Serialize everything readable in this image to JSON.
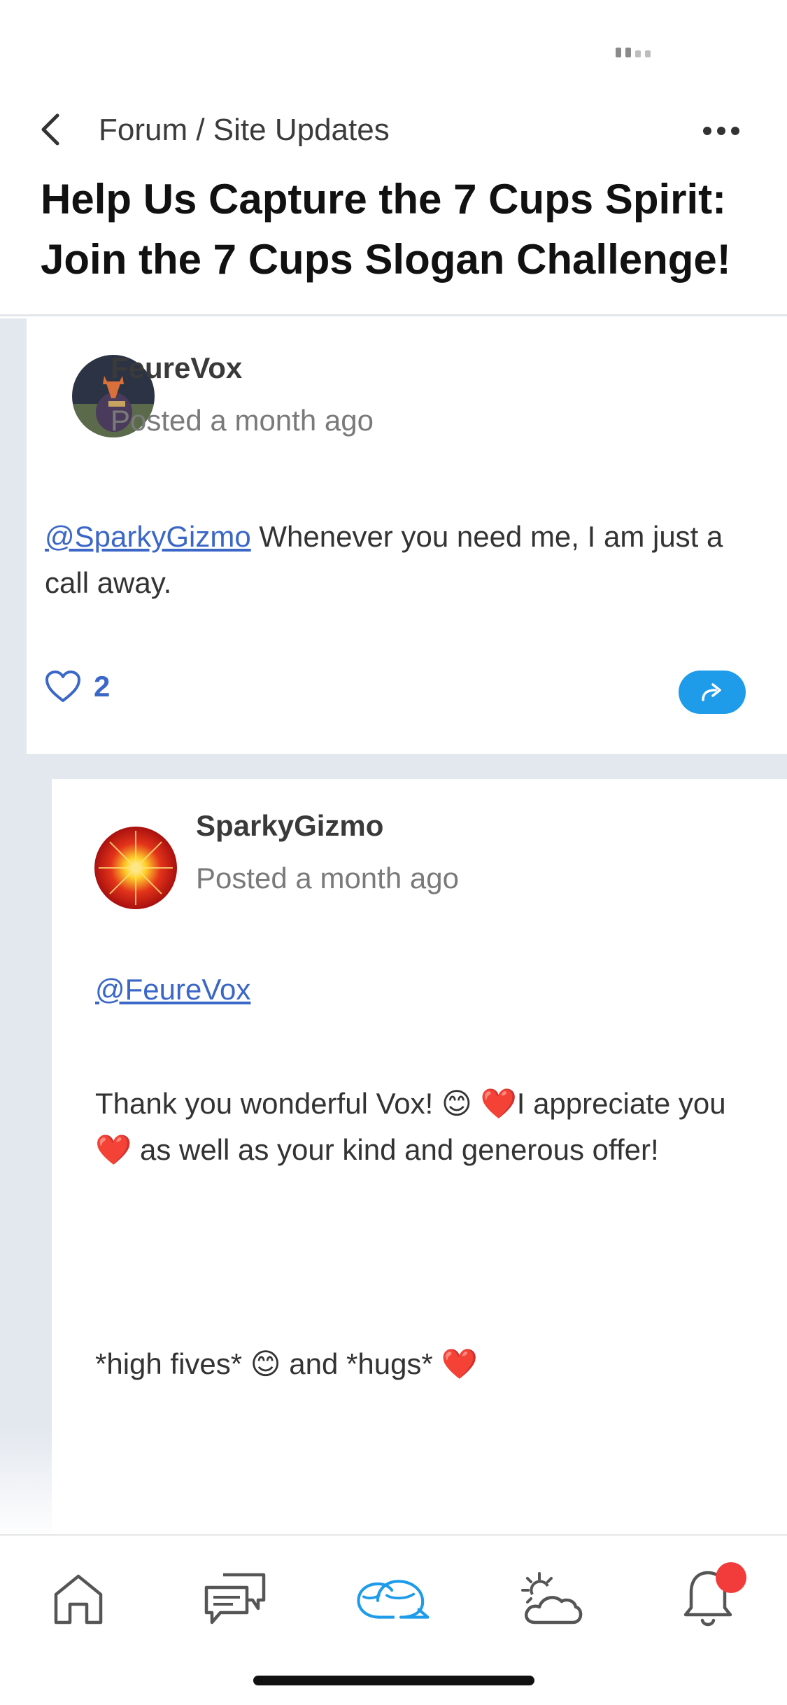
{
  "header": {
    "breadcrumb": "Forum / Site Updates",
    "title": "Help Us Capture the 7 Cups Spirit: Join the 7 Cups Slogan Challenge!"
  },
  "posts": [
    {
      "author": "FeureVox",
      "posted": "Posted a month ago",
      "mention": "@SparkyGizmo",
      "text": " Whenever you need me, I am just a call away.",
      "likes": "2"
    },
    {
      "author": "SparkyGizmo",
      "posted": "Posted a month ago",
      "mention": "@FeureVox",
      "paragraph1": {
        "part1": "Thank you wonderful Vox! ",
        "emoji1": "😊",
        "emoji2": "❤️",
        "part2": "I appreciate you ",
        "emoji3": "❤️",
        "part3": " as well as your kind and generous offer!"
      },
      "paragraph2": {
        "part1": "*high fives* ",
        "emoji1": "😊",
        "part2": " and *hugs* ",
        "emoji2": "❤️"
      }
    }
  ],
  "tabs": [
    {
      "icon": "home-icon"
    },
    {
      "icon": "chat-icon"
    },
    {
      "icon": "community-icon",
      "active": true
    },
    {
      "icon": "weather-icon"
    },
    {
      "icon": "bell-icon",
      "badge": true
    }
  ],
  "colors": {
    "accent": "#1e9be9",
    "link": "#3b67c7",
    "badge": "#f23b3b",
    "feed_bg": "#e3e8ef"
  }
}
